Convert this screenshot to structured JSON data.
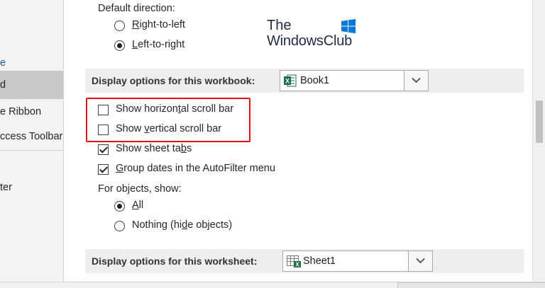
{
  "sidebar": {
    "items": [
      {
        "label": "e",
        "kind": "link"
      },
      {
        "label": "d",
        "kind": "selected"
      },
      {
        "label": "e Ribbon",
        "kind": "normal"
      },
      {
        "label": "ccess Toolbar",
        "kind": "normal"
      },
      {
        "label": "ter",
        "kind": "normal"
      }
    ]
  },
  "direction": {
    "heading": "Default direction:",
    "rtl_pre": "",
    "rtl_u": "R",
    "rtl_post": "ight-to-left",
    "ltr_pre": "",
    "ltr_u": "L",
    "ltr_post": "eft-to-right",
    "rtl_selected": false,
    "ltr_selected": true
  },
  "logo": {
    "line1": "The",
    "line2": "WindowsClub"
  },
  "workbook": {
    "title": "Display options for this workbook:",
    "selected": "Book1",
    "options": [
      {
        "pre": "Show horizon",
        "u": "t",
        "post": "al scroll bar",
        "checked": false
      },
      {
        "pre": "Show ",
        "u": "v",
        "post": "ertical scroll bar",
        "checked": false
      },
      {
        "pre": "Show sheet ta",
        "u": "b",
        "post": "s",
        "checked": true
      },
      {
        "pre": "",
        "u": "G",
        "post": "roup dates in the AutoFilter menu",
        "checked": true
      }
    ],
    "objects_heading": "For objects, show:",
    "obj_all_pre": "",
    "obj_all_u": "A",
    "obj_all_post": "ll",
    "obj_nothing_pre": "Nothing (hi",
    "obj_nothing_u": "d",
    "obj_nothing_post": "e objects)",
    "obj_all_selected": true,
    "obj_nothing_selected": false
  },
  "worksheet": {
    "title": "Display options for this worksheet:",
    "selected": "Sheet1"
  },
  "colors": {
    "highlight": "#e0121a",
    "excel_green": "#1d7044",
    "logo_blue": "#0078d7"
  }
}
